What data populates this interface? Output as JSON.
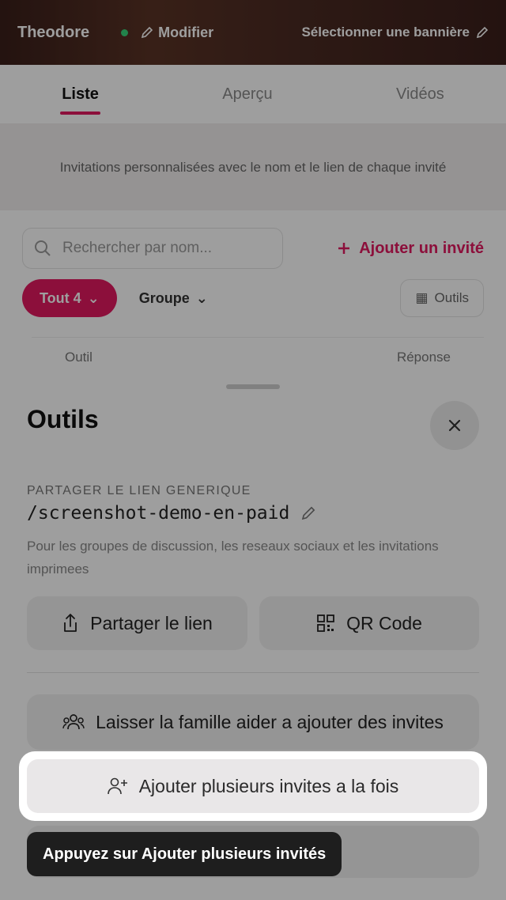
{
  "topbar": {
    "name": "Theodore",
    "edit_label": "Modifier",
    "select_label": "Sélectionner une bannière"
  },
  "tabs": [
    {
      "label": "Liste",
      "active": true
    },
    {
      "label": "Aperçu",
      "active": false
    },
    {
      "label": "Vidéos",
      "active": false
    }
  ],
  "banner": {
    "text": "Invitations personnalisées avec le nom et le lien de chaque invité"
  },
  "guest_list": {
    "search_placeholder": "Rechercher par nom...",
    "add_guest_label": "Ajouter un invité",
    "filter_all": "Tout 4",
    "filter_group": "Groupe",
    "tools_label": "Outils",
    "columns": [
      "Outil",
      "Réponse"
    ]
  },
  "sheet": {
    "title": "Outils",
    "share_section_label": "PARTAGER LE LIEN GENERIQUE",
    "link": "/screenshot-demo-en-paid",
    "link_description": "Pour les groupes de discussion, les reseaux sociaux et les invitations imprimees",
    "share_button": "Partager le lien",
    "qr_button": "QR Code",
    "family_button": "Laisser la famille aider a ajouter des invites",
    "bulk_button": "Ajouter plusieurs invites a la fois"
  },
  "tooltip": {
    "text": "Appuyez sur Ajouter plusieurs invités"
  },
  "colors": {
    "accent": "#e2195f",
    "tooltip_bg": "#1e1e1e",
    "button_bg": "#f1f0f0"
  }
}
